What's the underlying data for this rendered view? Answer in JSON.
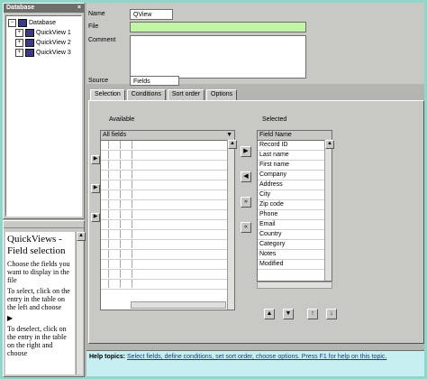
{
  "explorer": {
    "title": "Database",
    "root_label": "Database",
    "items": [
      {
        "label": "QuickView 1"
      },
      {
        "label": "QuickView 2"
      },
      {
        "label": "QuickView 3"
      }
    ]
  },
  "help": {
    "title": "QuickViews - Field selection",
    "paragraphs": [
      "Choose the fields you want to display in the file",
      "To select, click on the entry in the table on the left and choose",
      "To deselect, click on the entry in the table on the right and choose"
    ]
  },
  "form": {
    "name_label": "Name",
    "name_value": "QView",
    "file_label": "File",
    "file_value": "",
    "comment_label": "Comment",
    "comment_value": "",
    "source_label": "Source",
    "source_value": "Fields"
  },
  "tabs": [
    {
      "label": "Selection"
    },
    {
      "label": "Conditions"
    },
    {
      "label": "Sort order"
    },
    {
      "label": "Options"
    }
  ],
  "left_list": {
    "title": "Available",
    "dropdown_value": "All fields",
    "rows": [
      "",
      "",
      "",
      "",
      "",
      "",
      "",
      "",
      "",
      "",
      "",
      "",
      "",
      "",
      ""
    ]
  },
  "right_list": {
    "title": "Selected",
    "header": "Field Name",
    "rows": [
      "Record ID",
      "Last name",
      "First name",
      "Company",
      "Address",
      "City",
      "Zip code",
      "Phone",
      "Email",
      "Country",
      "Category",
      "Notes",
      "Modified"
    ]
  },
  "move_buttons": [
    {
      "symbol": "▶"
    },
    {
      "symbol": "◀"
    },
    {
      "symbol": "»"
    },
    {
      "symbol": "«"
    }
  ],
  "bottom_buttons": [
    {
      "symbol": "▲"
    },
    {
      "symbol": "▼"
    },
    {
      "symbol": "↑"
    },
    {
      "symbol": "↓"
    }
  ],
  "status": {
    "label": "Help topics:",
    "text": "Select fields, define conditions, set sort order, choose options. Press F1 for help on this topic."
  },
  "colors": {
    "background": "#b4b4b0",
    "selected_input": "#c2f4a6",
    "status_bar": "#c7eef0",
    "outer_frame": "#8fd7c8"
  }
}
